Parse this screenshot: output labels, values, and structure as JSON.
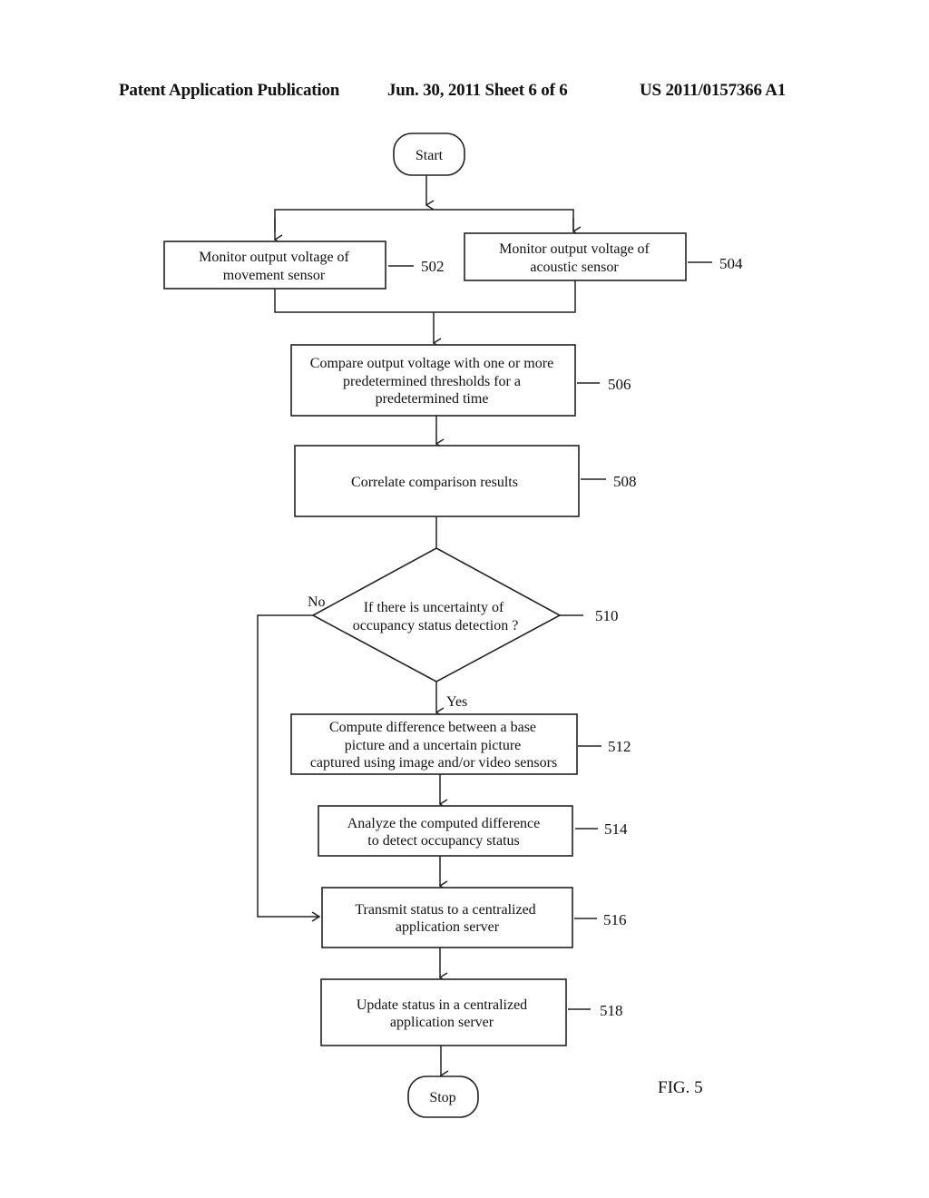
{
  "header": {
    "publication": "Patent Application Publication",
    "date_sheet": "Jun. 30, 2011   Sheet 6 of 6",
    "number": "US 2011/0157366 A1"
  },
  "figure_label": "FIG. 5",
  "terminals": {
    "start": "Start",
    "stop": "Stop"
  },
  "steps": {
    "s502": {
      "ref": "502",
      "lines": [
        "Monitor  output voltage of",
        "movement sensor"
      ]
    },
    "s504": {
      "ref": "504",
      "lines": [
        "Monitor  output voltage of",
        "acoustic sensor"
      ]
    },
    "s506": {
      "ref": "506",
      "lines": [
        "Compare output voltage with  one or more",
        "predetermined  thresholds for a",
        "predetermined time"
      ]
    },
    "s508": {
      "ref": "508",
      "lines": [
        "Correlate  comparison results"
      ]
    },
    "s510": {
      "ref": "510",
      "lines": [
        "If there is  uncertainty of",
        "occupancy status detection  ?"
      ]
    },
    "s512": {
      "ref": "512",
      "lines": [
        "Compute difference between  a base",
        "picture and a uncertain picture",
        "captured using image and/or video sensors"
      ]
    },
    "s514": {
      "ref": "514",
      "lines": [
        "Analyze the computed difference",
        "to detect occupancy status"
      ]
    },
    "s516": {
      "ref": "516",
      "lines": [
        "Transmit status to a centralized",
        "application  server"
      ]
    },
    "s518": {
      "ref": "518",
      "lines": [
        "Update  status  in  a centralized",
        "application  server"
      ]
    }
  },
  "branches": {
    "no": "No",
    "yes": "Yes"
  }
}
